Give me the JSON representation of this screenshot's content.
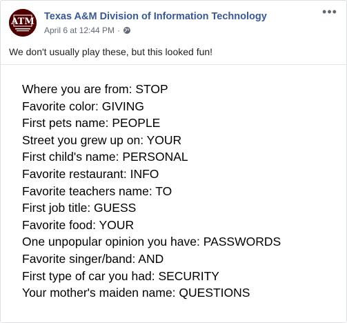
{
  "post": {
    "page_name": "Texas A&M Division of Information Technology",
    "date": "April 6 at 12:44 PM",
    "separator": "·",
    "caption": "We don't usually play these, but this looked fun!",
    "avatar_text": "ATM",
    "icons": {
      "more": "more-options-icon",
      "privacy": "globe-icon"
    }
  },
  "image_lines": [
    "Where you are from: STOP",
    "Favorite color: GIVING",
    "First pets name: PEOPLE",
    "Street you grew up on: YOUR",
    "First child's name: PERSONAL",
    "Favorite restaurant: INFO",
    "Favorite teachers name: TO",
    "First job title: GUESS",
    "Favorite food: YOUR",
    "One unpopular opinion you have: PASSWORDS",
    "Favorite singer/band: AND",
    "First type of car you had: SECURITY",
    "Your mother's maiden name: QUESTIONS"
  ],
  "colors": {
    "brand_maroon": "#500000",
    "link": "#385898",
    "meta": "#606770"
  }
}
